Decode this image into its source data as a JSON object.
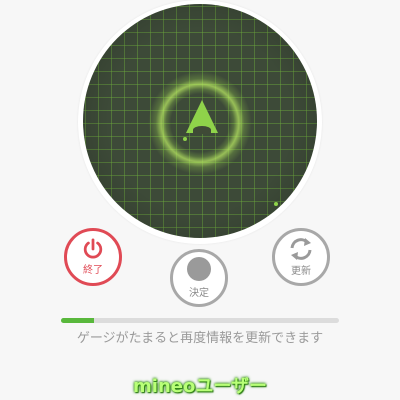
{
  "controls": {
    "end_label": "終了",
    "confirm_label": "決定",
    "update_label": "更新"
  },
  "progress": {
    "fraction": 0.12,
    "hint": "ゲージがたまると再度情報を更新できます"
  },
  "brand": {
    "text": "mineoユーザー"
  },
  "colors": {
    "accent_green": "#8fd34a",
    "end_red": "#e04a55",
    "progress_green": "#59b83c"
  }
}
